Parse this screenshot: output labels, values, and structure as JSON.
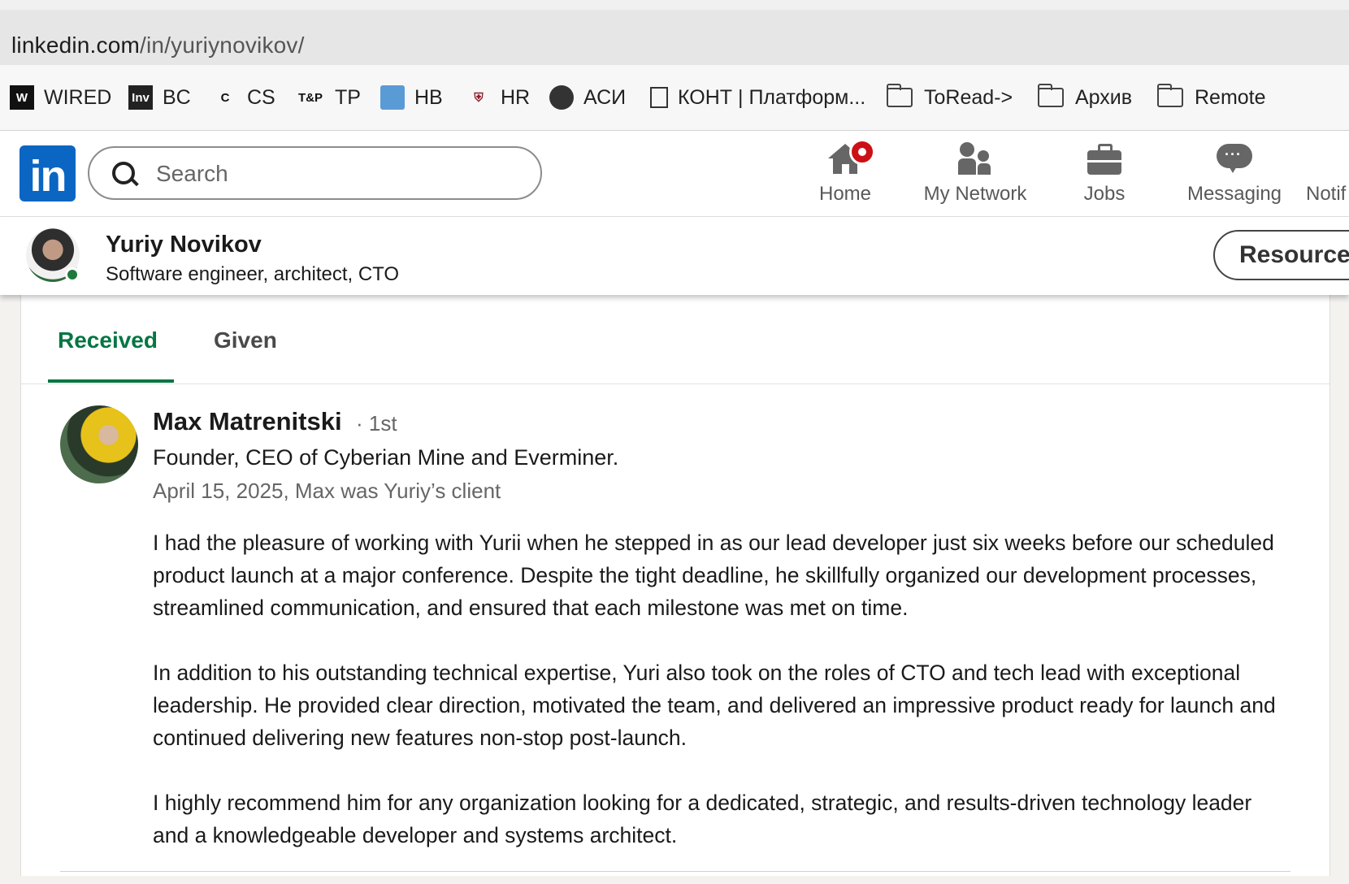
{
  "browser": {
    "url_domain": "linkedin.com",
    "url_path": "/in/yuriynovikov/"
  },
  "bookmarks": [
    {
      "label": "WIRED",
      "icon": "wired-logo-icon"
    },
    {
      "label": "BC",
      "icon": "vc-logo-icon"
    },
    {
      "label": "CS",
      "icon": "cs-logo-icon"
    },
    {
      "label": "TP",
      "icon": "tp-logo-icon"
    },
    {
      "label": "HB",
      "icon": "hb-logo-icon"
    },
    {
      "label": "HR",
      "icon": "hr-logo-icon"
    },
    {
      "label": "АСИ",
      "icon": "globe-icon"
    },
    {
      "label": "КОНТ | Платформ...",
      "icon": "document-icon"
    },
    {
      "label": "ToRead->",
      "icon": "folder-icon"
    },
    {
      "label": "Архив",
      "icon": "folder-icon"
    },
    {
      "label": "Remote",
      "icon": "folder-icon"
    }
  ],
  "bookmark_icon_text": {
    "wired": "W",
    "vc": "Inv",
    "cs": "C",
    "tp": "T&P"
  },
  "nav": {
    "logo": "in",
    "search_placeholder": "Search",
    "items": [
      {
        "label": "Home",
        "icon": "home-icon"
      },
      {
        "label": "My Network",
        "icon": "network-icon"
      },
      {
        "label": "Jobs",
        "icon": "briefcase-icon"
      },
      {
        "label": "Messaging",
        "icon": "message-icon"
      },
      {
        "label": "Notif",
        "icon": "bell-icon"
      }
    ]
  },
  "profile": {
    "name": "Yuriy Novikov",
    "headline": "Software engineer, architect, CTO",
    "resources_label": "Resources"
  },
  "recommendations": {
    "tabs": [
      {
        "label": "Received",
        "active": true
      },
      {
        "label": "Given",
        "active": false
      }
    ],
    "items": [
      {
        "name": "Max Matrenitski",
        "degree": "· 1st",
        "title": "Founder, CEO of Cyberian Mine and Everminer.",
        "date_relation": "April 15, 2025, Max was Yuriy’s client",
        "paragraphs": [
          "I had the pleasure of working with Yurii when he stepped in as our lead developer just six weeks before our scheduled product launch at a major conference. Despite the tight deadline, he skillfully organized our development processes, streamlined communication, and ensured that each milestone was met on time.",
          "In addition to his outstanding technical expertise, Yuri also took on the roles of CTO and tech lead with exceptional leadership. He provided clear direction, motivated the team, and delivered an impressive product ready for launch and continued delivering new features non-stop post-launch.",
          "I highly recommend him for any organization looking for a dedicated, strategic, and results-driven technology leader and a knowledgeable developer and systems architect."
        ]
      }
    ]
  },
  "colors": {
    "linkedin_blue": "#0a66c2",
    "active_tab_green": "#057642",
    "notification_red": "#cc1016",
    "online_green": "#1e7a3c"
  }
}
